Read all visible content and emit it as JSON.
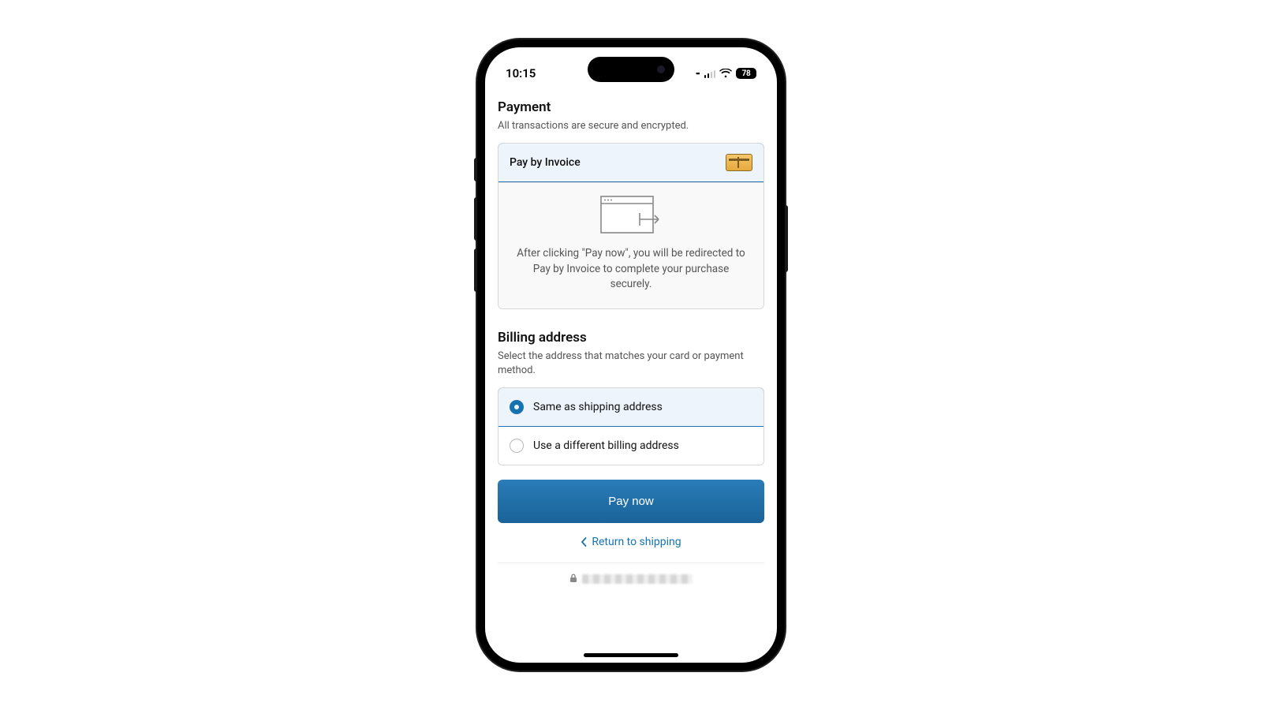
{
  "status": {
    "time": "10:15",
    "battery": "78"
  },
  "payment": {
    "title": "Payment",
    "subtitle": "All transactions are secure and encrypted.",
    "method_label": "Pay by Invoice",
    "redirect_text": "After clicking \"Pay now\", you will be redirected to Pay by Invoice to complete your purchase securely."
  },
  "billing": {
    "title": "Billing address",
    "subtitle": "Select the address that matches your card or payment method.",
    "options": {
      "same": "Same as shipping address",
      "different": "Use a different billing address"
    }
  },
  "actions": {
    "pay": "Pay now",
    "return": "Return to shipping"
  }
}
